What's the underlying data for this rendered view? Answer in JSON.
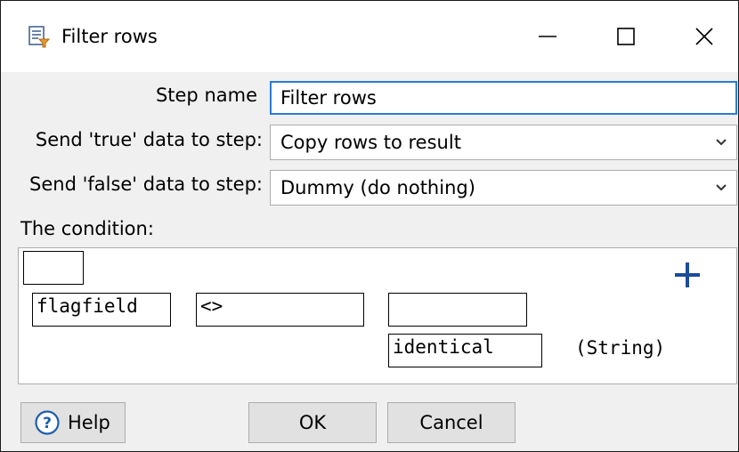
{
  "window": {
    "title": "Filter rows",
    "icon": "filter-rows-step-icon"
  },
  "form": {
    "step_name_label": "Step name",
    "step_name_value": "Filter rows",
    "true_label": "Send 'true' data to step:",
    "true_value": "Copy rows to result",
    "false_label": "Send 'false' data to step:",
    "false_value": "Dummy (do nothing)"
  },
  "condition": {
    "label": "The condition:",
    "negate_box": "",
    "field": "flagfield",
    "operator": "<>",
    "value": "",
    "function": "identical",
    "type": "(String)",
    "add_icon": "plus-icon"
  },
  "buttons": {
    "help": "Help",
    "ok": "OK",
    "cancel": "Cancel"
  },
  "colors": {
    "accent": "#2b7bd4",
    "plus": "#1c4c9a",
    "help_icon": "#1f5fa8"
  }
}
